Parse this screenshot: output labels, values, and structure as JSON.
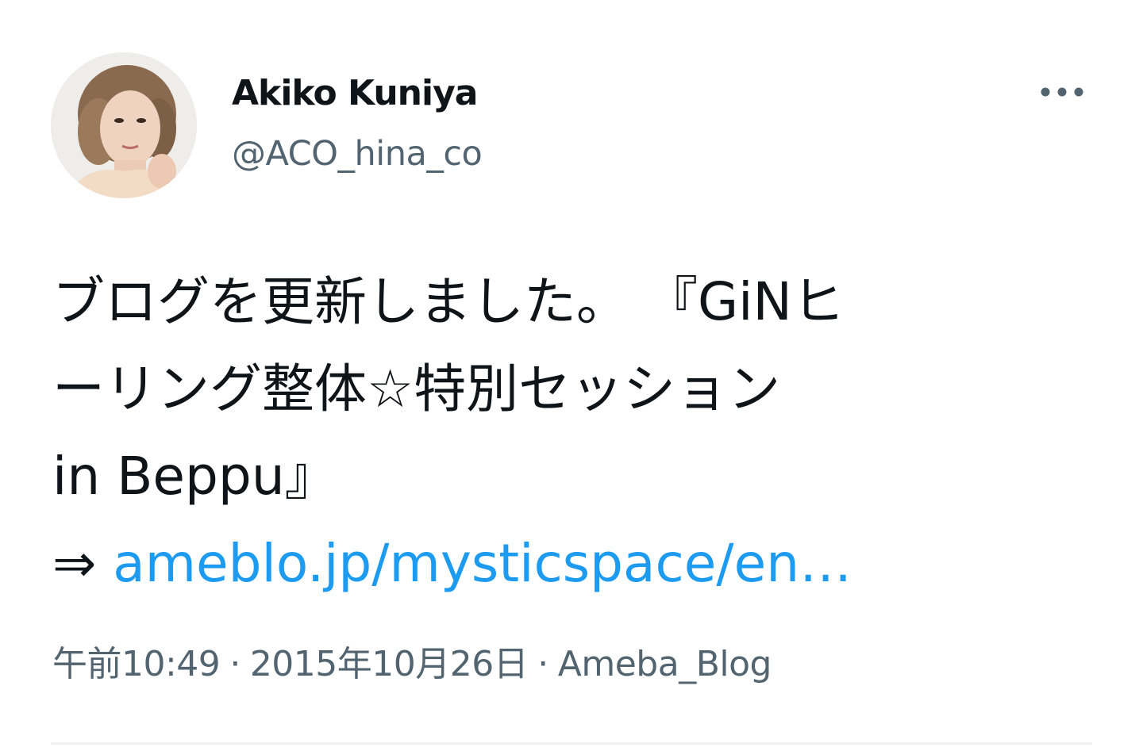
{
  "author": {
    "display_name": "Akiko Kuniya",
    "handle": "@ACO_hina_co",
    "avatar_icon": "profile-photo-avatar"
  },
  "more_menu": {
    "icon": "more-horizontal-icon"
  },
  "tweet": {
    "lines": [
      "ブログを更新しました。 『GiNヒ",
      "ーリング整体☆特別セッション",
      "in Beppu』"
    ],
    "arrow": "⇒",
    "link_text": "ameblo.jp/mysticspace/en…"
  },
  "meta": {
    "time": "午前10:49",
    "separator": "·",
    "date": "2015年10月26日",
    "source": "Ameba_Blog"
  },
  "colors": {
    "link": "#1d9bf0",
    "secondary_text": "#536471",
    "primary_text": "#0f1419",
    "divider": "#eff3f4"
  }
}
